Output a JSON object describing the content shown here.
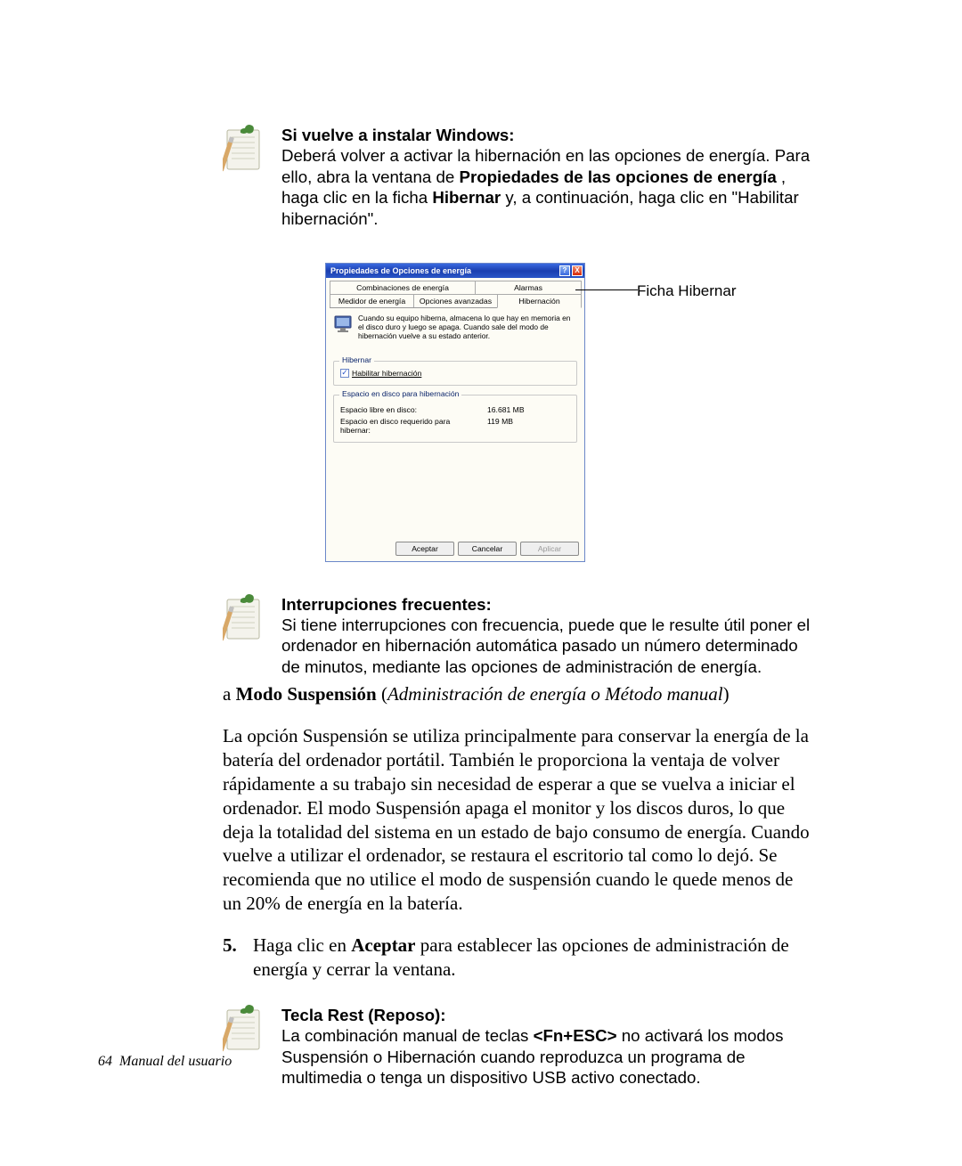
{
  "note1": {
    "heading": "Si vuelve a instalar Windows:",
    "text_before_bold1": "Deberá volver a activar la hibernación en las opciones de energía. Para ello, abra la ventana de ",
    "bold1": "Propiedades de las opciones de energía",
    "mid_text": " , haga clic en la ficha ",
    "bold2": "Hibernar",
    "text_after_bold2": " y, a continuación, haga clic en \"Habilitar hibernación\"."
  },
  "xp": {
    "title": "Propiedades de Opciones de energía",
    "help": "?",
    "close": "X",
    "tabs_top": [
      "Combinaciones de energía",
      "Alarmas"
    ],
    "tabs_bottom": [
      "Medidor de energía",
      "Opciones avanzadas",
      "Hibernación"
    ],
    "desc": "Cuando su equipo hiberna, almacena lo que hay en memoria en el disco duro y luego se apaga. Cuando sale del modo de hibernación vuelve a su estado anterior.",
    "group1_title": "Hibernar",
    "chk_label": "Habilitar hibernación",
    "group2_title": "Espacio en disco para hibernación",
    "row1_label": "Espacio libre en disco:",
    "row1_value": "16.681 MB",
    "row2_label": "Espacio en disco requerido para hibernar:",
    "row2_value": "119 MB",
    "btn_ok": "Aceptar",
    "btn_cancel": "Cancelar",
    "btn_apply": "Aplicar",
    "callout": "Ficha Hibernar"
  },
  "note2": {
    "heading": "Interrupciones frecuentes:",
    "text": "Si tiene interrupciones con frecuencia, puede que le resulte útil poner el ordenador en hibernación automática pasado un número determinado de minutos, mediante las opciones de administración de energía."
  },
  "serif": {
    "heading_prefix": "a ",
    "heading_bold": "Modo Suspensión",
    "heading_paren_open": " (",
    "heading_italic": "Administración de energía o Método manual",
    "heading_paren_close": ")",
    "body": "La opción Suspensión se utiliza principalmente para conservar la energía de la batería del ordenador portátil. También le proporciona la ventaja de volver rápidamente a su trabajo sin necesidad de esperar a que se vuelva a iniciar el ordenador. El modo Suspensión apaga el monitor y los discos duros, lo que deja la totalidad del sistema en un estado de bajo consumo de energía. Cuando vuelve a utilizar el ordenador, se restaura el escritorio tal como lo dejó. Se recomienda que no utilice el modo de suspensión cuando le quede menos de un 20% de energía en la batería."
  },
  "step5": {
    "num": "5.",
    "before_bold": "Haga clic en ",
    "bold": "Aceptar",
    "after_bold": " para establecer las opciones de administración de energía y cerrar la ventana."
  },
  "note3": {
    "heading": "Tecla Rest (Reposo):",
    "before_bold": "La combinación manual de teclas ",
    "bold": "<Fn+ESC>",
    "after_bold": " no activará los modos Suspensión o Hibernación cuando reproduzca un programa de multimedia o tenga un dispositivo USB activo conectado."
  },
  "footer": {
    "page": "64",
    "title": "Manual del usuario"
  }
}
